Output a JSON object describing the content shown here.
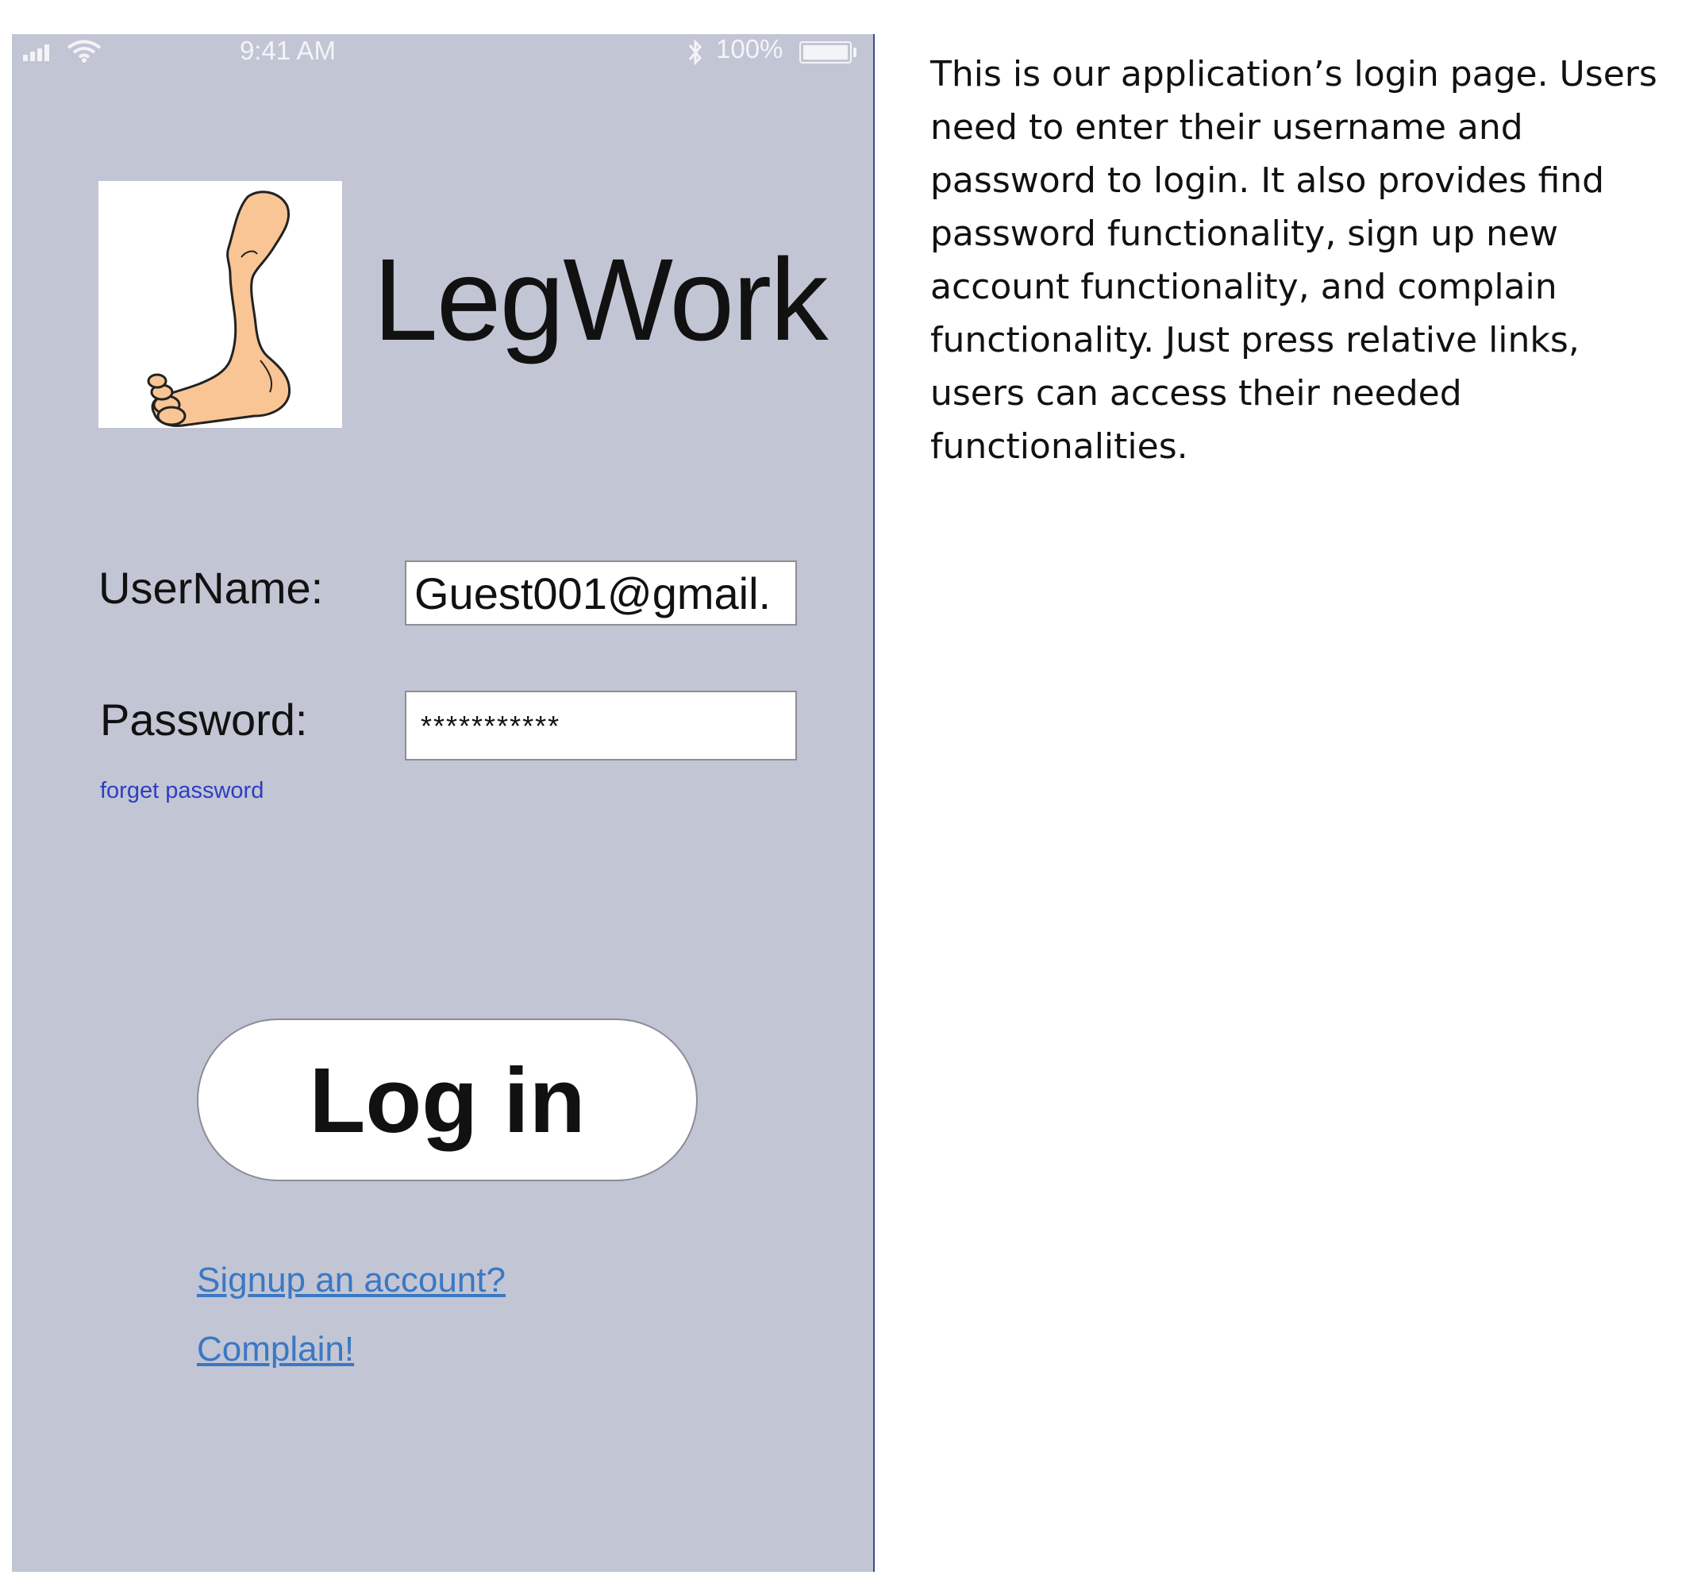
{
  "status_bar": {
    "time": "9:41 AM",
    "battery_percent": "100%",
    "battery_level": 1.0,
    "icons": [
      "signal-icon",
      "wifi-icon",
      "bluetooth-icon",
      "battery-icon"
    ]
  },
  "app": {
    "title": "LegWork",
    "logo_icon": "foot-leg-icon"
  },
  "form": {
    "username_label": "UserName:",
    "username_value": "Guest001@gmail.",
    "password_label": "Password:",
    "password_value": "***********",
    "forget_password": "forget password"
  },
  "actions": {
    "login_label": "Log in",
    "signup_link": "Signup an account?",
    "complain_link": "Complain!"
  },
  "description": "This is our application’s login page. Users need to enter their username and password to login. It also provides find password functionality, sign up new account functionality, and complain functionality. Just press relative links, users can access their needed functionalities.",
  "colors": {
    "phone_background": "#c2c5d4",
    "link_blue": "#3a78c4",
    "forget_link_blue": "#2c3fc0",
    "logo_skin": "#f9c594"
  }
}
